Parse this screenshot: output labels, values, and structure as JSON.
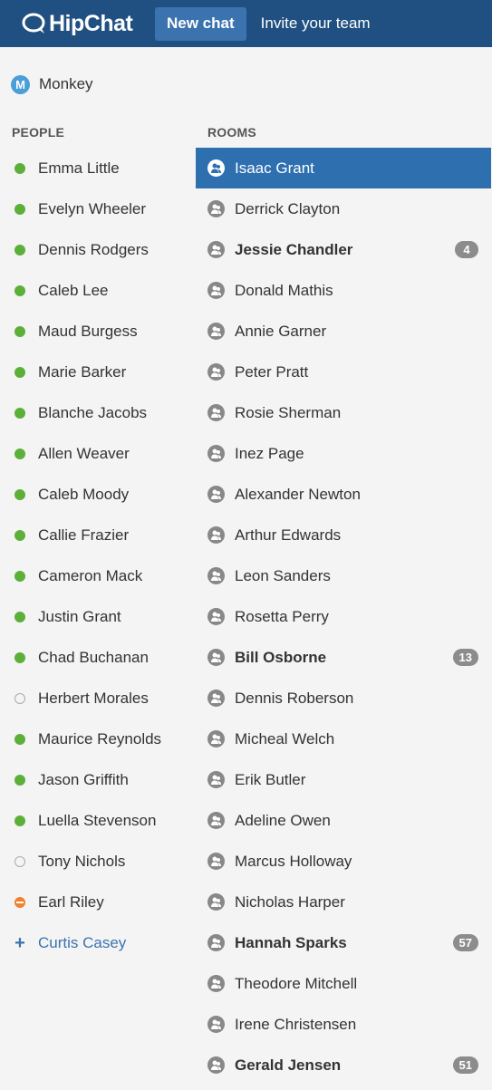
{
  "header": {
    "logo_text": "HipChat",
    "new_chat_label": "New chat",
    "invite_label": "Invite your team"
  },
  "self": {
    "initial": "M",
    "name": "Monkey"
  },
  "sections": {
    "people": "PEOPLE",
    "rooms": "ROOMS"
  },
  "people": [
    {
      "name": "Emma Little",
      "status": "online"
    },
    {
      "name": "Evelyn Wheeler",
      "status": "online"
    },
    {
      "name": "Dennis Rodgers",
      "status": "online"
    },
    {
      "name": "Caleb Lee",
      "status": "online"
    },
    {
      "name": "Maud Burgess",
      "status": "online"
    },
    {
      "name": "Marie Barker",
      "status": "online"
    },
    {
      "name": "Blanche Jacobs",
      "status": "online"
    },
    {
      "name": "Allen Weaver",
      "status": "online"
    },
    {
      "name": "Caleb Moody",
      "status": "online"
    },
    {
      "name": "Callie Frazier",
      "status": "online"
    },
    {
      "name": "Cameron Mack",
      "status": "online"
    },
    {
      "name": "Justin Grant",
      "status": "online"
    },
    {
      "name": "Chad Buchanan",
      "status": "online"
    },
    {
      "name": "Herbert Morales",
      "status": "offline"
    },
    {
      "name": "Maurice Reynolds",
      "status": "online"
    },
    {
      "name": "Jason Griffith",
      "status": "online"
    },
    {
      "name": "Luella Stevenson",
      "status": "online"
    },
    {
      "name": "Tony Nichols",
      "status": "offline"
    },
    {
      "name": "Earl Riley",
      "status": "dnd"
    }
  ],
  "add_person": {
    "name": "Curtis Casey",
    "icon": "plus-icon"
  },
  "rooms": [
    {
      "name": "Isaac Grant",
      "active": true
    },
    {
      "name": "Derrick Clayton"
    },
    {
      "name": "Jessie Chandler",
      "unread": "4"
    },
    {
      "name": "Donald Mathis"
    },
    {
      "name": "Annie Garner"
    },
    {
      "name": "Peter Pratt"
    },
    {
      "name": "Rosie Sherman"
    },
    {
      "name": "Inez Page"
    },
    {
      "name": "Alexander Newton"
    },
    {
      "name": "Arthur Edwards"
    },
    {
      "name": "Leon Sanders"
    },
    {
      "name": "Rosetta Perry"
    },
    {
      "name": "Bill Osborne",
      "unread": "13"
    },
    {
      "name": "Dennis Roberson"
    },
    {
      "name": "Micheal Welch"
    },
    {
      "name": "Erik Butler"
    },
    {
      "name": "Adeline Owen"
    },
    {
      "name": "Marcus Holloway"
    },
    {
      "name": "Nicholas Harper"
    },
    {
      "name": "Hannah Sparks",
      "unread": "57"
    },
    {
      "name": "Theodore Mitchell"
    },
    {
      "name": "Irene Christensen"
    },
    {
      "name": "Gerald Jensen",
      "unread": "51"
    }
  ],
  "colors": {
    "header_bg": "#205081",
    "button_bg": "#3b73af",
    "active_room_bg": "#2e6fb0",
    "online": "#5cb039",
    "dnd": "#f0812e"
  }
}
